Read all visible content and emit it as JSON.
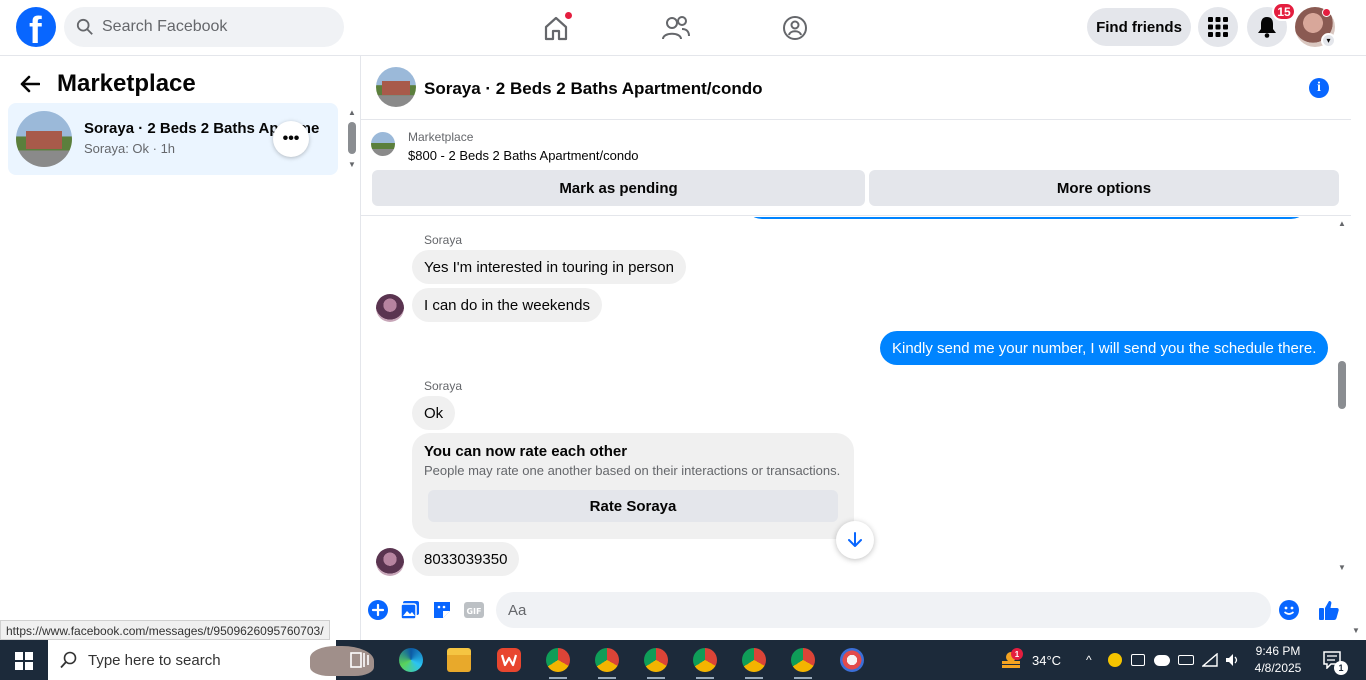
{
  "search": {
    "placeholder": "Search Facebook"
  },
  "header": {
    "find_friends": "Find friends",
    "notification_count": "15"
  },
  "left": {
    "title": "Marketplace",
    "conversation": {
      "name": "Soraya · 2 Beds 2 Baths Apartment/condo",
      "preview": "Soraya: Ok · 1h",
      "more": "•••"
    }
  },
  "chat": {
    "title": "Soraya · 2 Beds 2 Baths Apartment/condo",
    "marketplace_label": "Marketplace",
    "listing": "$800 - 2 Beds 2 Baths Apartment/condo",
    "mark_pending": "Mark as pending",
    "more_options": "More options"
  },
  "messages": {
    "sender1": "Soraya",
    "m1": "Yes I'm interested in touring in person",
    "m2": "I can do in the weekends",
    "m3": "Kindly send me your number, I will send you the schedule there.",
    "sender2": "Soraya",
    "m4": "Ok",
    "rate_title": "You can now rate each other",
    "rate_desc": "People may rate one another based on their interactions or transactions.",
    "rate_button": "Rate Soraya",
    "m5": "8033039350"
  },
  "composer": {
    "placeholder": "Aa"
  },
  "status_bar": {
    "url": "https://www.facebook.com/messages/t/9509626095760703/"
  },
  "taskbar": {
    "search": "Type here to search",
    "weather": "34°C",
    "weather_badge": "1",
    "time": "9:46 PM",
    "date": "4/8/2025",
    "notifications": "1"
  },
  "colors": {
    "brand": "#0866ff",
    "outgoing_bubble": "#0084ff",
    "badge": "#e41e3f"
  }
}
